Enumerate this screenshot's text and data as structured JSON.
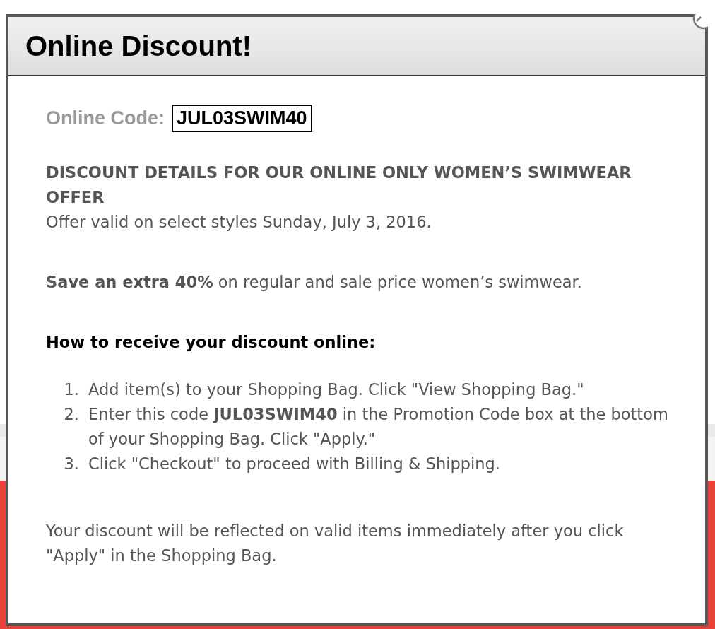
{
  "dialog": {
    "title": "Online Discount!",
    "code_label": "Online Code:",
    "code": "JUL03SWIM40",
    "details_heading": "DISCOUNT DETAILS FOR OUR ONLINE ONLY WOMEN’S SWIMWEAR OFFER",
    "validity": "Offer valid on select styles Sunday, July 3, 2016.",
    "offer": "**Save an extra 40%** on regular and sale price women’s swimwear.",
    "steps_heading": "How to receive your discount online:",
    "steps": [
      {
        "number": "1.",
        "text": "Add item(s) to your Shopping Bag. Click \"View Shopping Bag.\""
      },
      {
        "number": "2.",
        "text": "Enter this code **JUL03SWIM40** in the Promotion Code box at the bottom of your Shopping Bag. Click \"Apply.\""
      },
      {
        "number": "3.",
        "text": "Click \"Checkout\" to proceed with Billing & Shipping."
      }
    ],
    "footer_note": "Your discount will be reflected on valid items immediately after you click \"Apply\" in the Shopping Bag."
  }
}
